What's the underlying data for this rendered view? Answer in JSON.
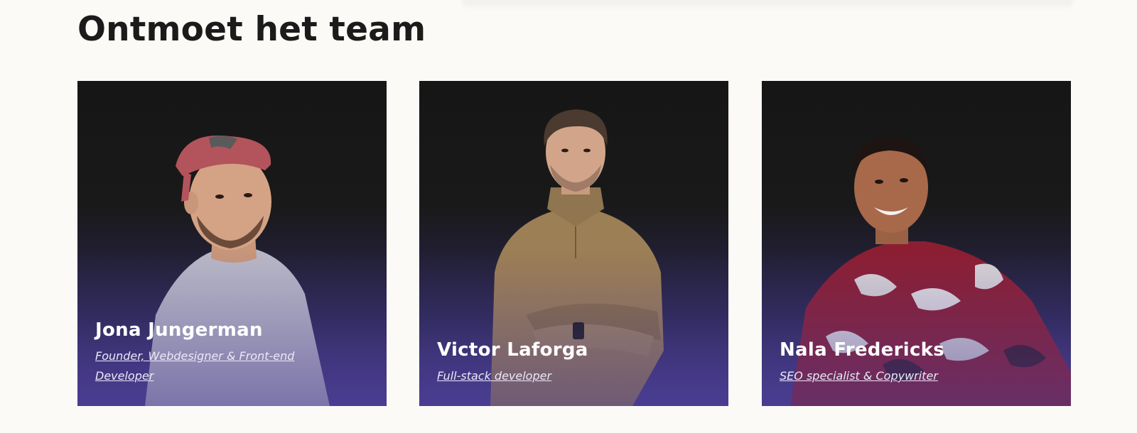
{
  "section": {
    "title": "Ontmoet het team"
  },
  "team": [
    {
      "name": "Jona Jungerman",
      "role": "Founder, Webdesigner & Front-end Developer"
    },
    {
      "name": "Victor Laforga",
      "role": "Full-stack developer"
    },
    {
      "name": "Nala Fredericks",
      "role": "SEO specialist & Copywriter"
    }
  ],
  "colors": {
    "background": "#fbfaf6",
    "title": "#1b1b1b",
    "card_top": "#161616",
    "card_bottom": "#4a3d92"
  }
}
